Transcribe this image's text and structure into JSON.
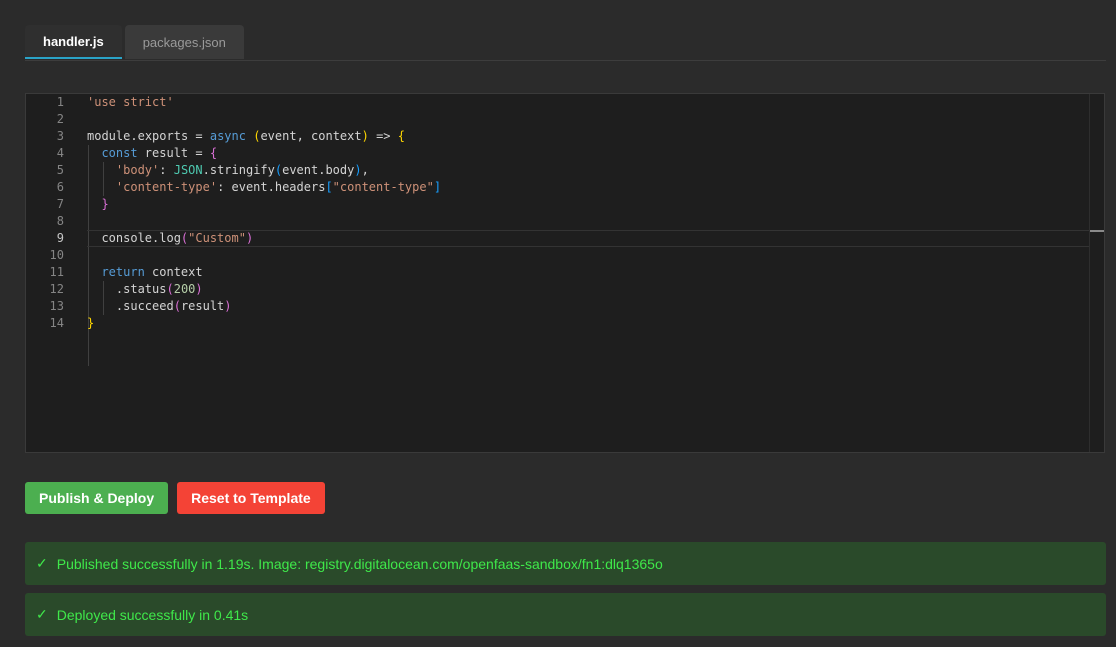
{
  "tabs": [
    {
      "label": "handler.js",
      "active": true
    },
    {
      "label": "packages.json",
      "active": false
    }
  ],
  "editor": {
    "current_line": 9,
    "lines": [
      [
        [
          "'use strict'",
          "t-str"
        ]
      ],
      [],
      [
        [
          "module",
          "t-id"
        ],
        [
          ".",
          "t-id"
        ],
        [
          "exports",
          "t-id"
        ],
        [
          " = ",
          "t-id"
        ],
        [
          "async",
          "t-kw"
        ],
        [
          " ",
          "t-id"
        ],
        [
          "(",
          "t-b1"
        ],
        [
          "event, context",
          "t-id"
        ],
        [
          ")",
          "t-b1"
        ],
        [
          " => ",
          "t-id"
        ],
        [
          "{",
          "t-b1"
        ]
      ],
      [
        [
          "  ",
          "t-id"
        ],
        [
          "const",
          "t-kw"
        ],
        [
          " result = ",
          "t-id"
        ],
        [
          "{",
          "t-b2"
        ]
      ],
      [
        [
          "    ",
          "t-id"
        ],
        [
          "'body'",
          "t-str"
        ],
        [
          ": ",
          "t-id"
        ],
        [
          "JSON",
          "t-cls"
        ],
        [
          ".stringify",
          "t-id"
        ],
        [
          "(",
          "t-b3"
        ],
        [
          "event.body",
          "t-id"
        ],
        [
          ")",
          "t-b3"
        ],
        [
          ",",
          "t-id"
        ]
      ],
      [
        [
          "    ",
          "t-id"
        ],
        [
          "'content-type'",
          "t-str"
        ],
        [
          ": event.headers",
          "t-id"
        ],
        [
          "[",
          "t-b3"
        ],
        [
          "\"content-type\"",
          "t-str"
        ],
        [
          "]",
          "t-b3"
        ]
      ],
      [
        [
          "  ",
          "t-id"
        ],
        [
          "}",
          "t-b2"
        ]
      ],
      [],
      [
        [
          "  console.log",
          "t-id"
        ],
        [
          "(",
          "t-b2"
        ],
        [
          "\"Custom\"",
          "t-str"
        ],
        [
          ")",
          "t-b2"
        ]
      ],
      [],
      [
        [
          "  ",
          "t-id"
        ],
        [
          "return",
          "t-kw"
        ],
        [
          " context",
          "t-id"
        ]
      ],
      [
        [
          "    .status",
          "t-id"
        ],
        [
          "(",
          "t-b2"
        ],
        [
          "200",
          "t-num"
        ],
        [
          ")",
          "t-b2"
        ]
      ],
      [
        [
          "    .succeed",
          "t-id"
        ],
        [
          "(",
          "t-b2"
        ],
        [
          "result",
          "t-id"
        ],
        [
          ")",
          "t-b2"
        ]
      ],
      [
        [
          "}",
          "t-b1"
        ]
      ]
    ]
  },
  "actions": {
    "publish_label": "Publish & Deploy",
    "reset_label": "Reset to Template"
  },
  "status": [
    {
      "check": "✓",
      "text": "Published successfully in 1.19s. Image: registry.digitalocean.com/openfaas-sandbox/fn1:dlq1365o"
    },
    {
      "check": "✓",
      "text": "Deployed successfully in 0.41s"
    }
  ],
  "colors": {
    "publish": "#4caf50",
    "reset": "#f44336",
    "success_text": "#3fe84a",
    "success_bg": "#2a4a2a",
    "tab_accent": "#2aa3c7"
  }
}
